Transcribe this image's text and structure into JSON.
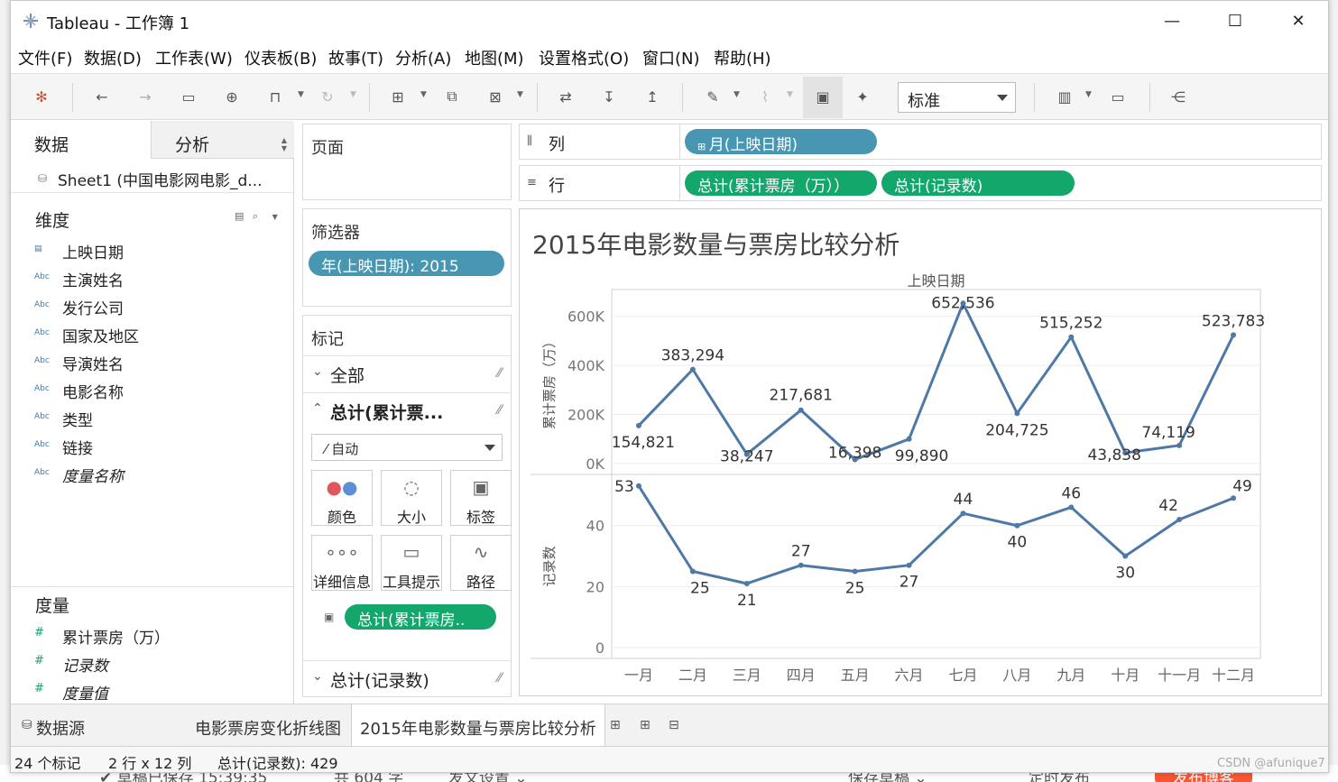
{
  "window": {
    "title": "Tableau - 工作簿 1",
    "minimize": "—",
    "maximize": "☐",
    "close": "✕"
  },
  "menu": [
    {
      "label": "文件(F)"
    },
    {
      "label": "数据(D)"
    },
    {
      "label": "工作表(W)"
    },
    {
      "label": "仪表板(B)"
    },
    {
      "label": "故事(T)"
    },
    {
      "label": "分析(A)"
    },
    {
      "label": "地图(M)"
    },
    {
      "label": "设置格式(O)"
    },
    {
      "label": "窗口(N)"
    },
    {
      "label": "帮助(H)"
    }
  ],
  "toolbar": {
    "fit_value": "标准",
    "icons": [
      "tableau-logo-icon",
      "undo-icon",
      "redo-icon",
      "save-icon",
      "new-datasource-icon",
      "pause-updates-icon",
      "refresh-icon",
      "new-worksheet-icon",
      "duplicate-icon",
      "clear-icon",
      "swap-icon",
      "sort-asc-icon",
      "sort-desc-icon",
      "highlight-icon",
      "group-icon",
      "label-icon",
      "pin-icon",
      "show-me-icon",
      "presentation-icon",
      "share-icon"
    ]
  },
  "data_pane": {
    "tab_data": "数据",
    "tab_analysis": "分析",
    "datasource": "Sheet1 (中国电影网电影_d...",
    "dimensions_title": "维度",
    "dimensions": [
      {
        "icon": "date-icon",
        "label": "上映日期",
        "italic": false
      },
      {
        "icon": "abc-icon",
        "label": "主演姓名",
        "italic": false
      },
      {
        "icon": "abc-icon",
        "label": "发行公司",
        "italic": false
      },
      {
        "icon": "abc-icon",
        "label": "国家及地区",
        "italic": false
      },
      {
        "icon": "abc-icon",
        "label": "导演姓名",
        "italic": false
      },
      {
        "icon": "abc-icon",
        "label": "电影名称",
        "italic": false
      },
      {
        "icon": "abc-icon",
        "label": "类型",
        "italic": false
      },
      {
        "icon": "abc-icon",
        "label": "链接",
        "italic": false
      },
      {
        "icon": "abc-icon",
        "label": "度量名称",
        "italic": true
      }
    ],
    "measures_title": "度量",
    "measures": [
      {
        "icon": "measure-icon",
        "label": "累计票房（万）",
        "italic": false
      },
      {
        "icon": "measure-icon",
        "label": "记录数",
        "italic": true
      },
      {
        "icon": "measure-icon",
        "label": "度量值",
        "italic": true
      }
    ]
  },
  "cards": {
    "pages_title": "页面",
    "filters_title": "筛选器",
    "filter_pill": "年(上映日期): 2015",
    "marks_title": "标记",
    "marks_all": "全部",
    "marks_series1": "总计(累计票...",
    "mark_type": "自动",
    "mark_buttons": [
      {
        "icon": "color-icon",
        "label": "颜色"
      },
      {
        "icon": "size-icon",
        "label": "大小"
      },
      {
        "icon": "label-icon",
        "label": "标签"
      },
      {
        "icon": "detail-icon",
        "label": "详细信息"
      },
      {
        "icon": "tooltip-icon",
        "label": "工具提示"
      },
      {
        "icon": "path-icon",
        "label": "路径"
      }
    ],
    "label_pill": "总计(累计票房..",
    "marks_series2": "总计(记录数)"
  },
  "shelves": {
    "columns_label": "列",
    "columns_pill": "月(上映日期)",
    "rows_label": "行",
    "rows_pills": [
      "总计(累计票房（万））",
      "总计(记录数)"
    ]
  },
  "chart_data": {
    "type": "line",
    "title": "2015年电影数量与票房比较分析",
    "x_header": "上映日期",
    "categories": [
      "一月",
      "二月",
      "三月",
      "四月",
      "五月",
      "六月",
      "七月",
      "八月",
      "九月",
      "十月",
      "十一月",
      "十二月"
    ],
    "series": [
      {
        "name": "累计票房（万）",
        "values": [
          154821,
          383294,
          38247,
          217681,
          16398,
          99890,
          652536,
          204725,
          515252,
          43838,
          74119,
          523783
        ],
        "labels": [
          "154,821",
          "383,294",
          "38,247",
          "217,681",
          "16,398",
          "99,890",
          "652,536",
          "204,725",
          "515,252",
          "43,838",
          "74,119",
          "523,783"
        ],
        "ylabel": "累计票房（万）",
        "ylim": [
          0,
          650000
        ],
        "ticks": [
          0,
          200000,
          400000,
          600000
        ],
        "tick_labels": [
          "0K",
          "200K",
          "400K",
          "600K"
        ]
      },
      {
        "name": "记录数",
        "values": [
          53,
          25,
          21,
          27,
          25,
          27,
          44,
          40,
          46,
          30,
          42,
          49
        ],
        "labels": [
          "53",
          "25",
          "21",
          "27",
          "25",
          "27",
          "44",
          "40",
          "46",
          "30",
          "42",
          "49"
        ],
        "ylabel": "记录数",
        "ylim": [
          0,
          55
        ],
        "ticks": [
          0,
          20,
          40
        ],
        "tick_labels": [
          "0",
          "20",
          "40"
        ]
      }
    ],
    "line_color": "#4e79a7",
    "grid": true
  },
  "sheet_tabs": {
    "datasource_tab": "数据源",
    "tabs": [
      {
        "label": "电影票房变化折线图",
        "active": false
      },
      {
        "label": "2015年电影数量与票房比较分析",
        "active": true
      }
    ]
  },
  "status": {
    "marks": "24 个标记",
    "dims": "2 行 x 12 列",
    "sum": "总计(记录数): 429"
  },
  "watermark": "CSDN @afunique7"
}
